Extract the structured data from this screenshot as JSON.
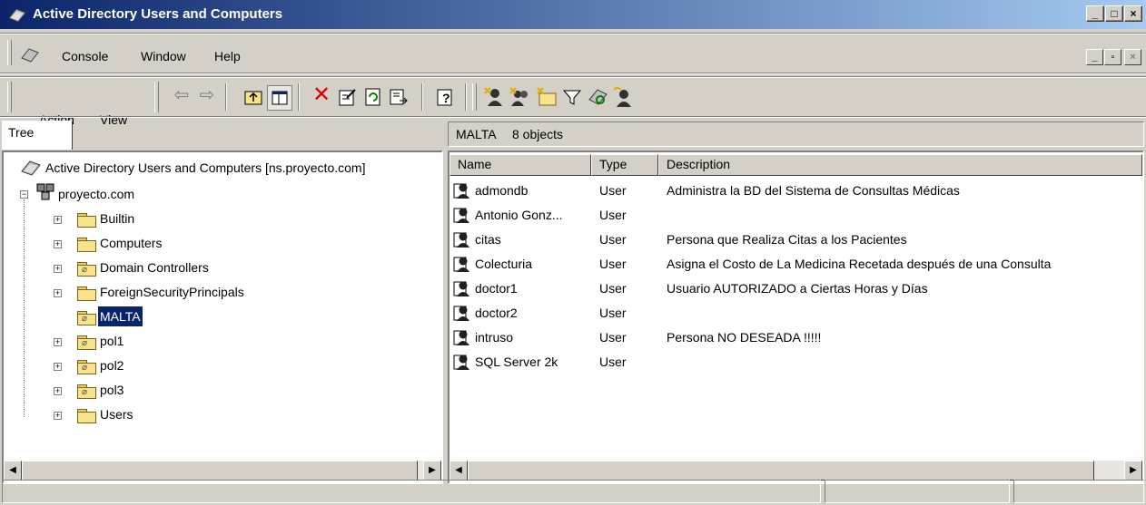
{
  "window": {
    "title": "Active Directory Users and Computers",
    "caption_buttons": [
      "_",
      "□",
      "×"
    ]
  },
  "menu": {
    "items": [
      "Console",
      "Window",
      "Help"
    ],
    "mdi_buttons": [
      "_",
      "▫",
      "×"
    ]
  },
  "toolbar": {
    "action_label": "Action",
    "view_label": "View",
    "icons": [
      "back-icon",
      "forward-icon",
      "up-folder-icon",
      "show-tree-icon",
      "delete-icon",
      "properties-icon",
      "refresh-icon",
      "export-icon",
      "help-icon",
      "new-user-icon",
      "new-group-icon",
      "new-ou-icon",
      "filter-icon",
      "find-icon",
      "add-to-group-icon"
    ]
  },
  "tree": {
    "tab_label": "Tree",
    "root_label": "Active Directory Users and Computers [ns.proyecto.com]",
    "domain_label": "proyecto.com",
    "nodes": [
      {
        "label": "Builtin",
        "kind": "container"
      },
      {
        "label": "Computers",
        "kind": "container"
      },
      {
        "label": "Domain Controllers",
        "kind": "ou"
      },
      {
        "label": "ForeignSecurityPrincipals",
        "kind": "container"
      },
      {
        "label": "MALTA",
        "kind": "ou",
        "selected": true
      },
      {
        "label": "pol1",
        "kind": "ou"
      },
      {
        "label": "pol2",
        "kind": "ou"
      },
      {
        "label": "pol3",
        "kind": "ou"
      },
      {
        "label": "Users",
        "kind": "container"
      }
    ]
  },
  "list": {
    "header_title": "MALTA",
    "header_count": "8 objects",
    "columns": [
      "Name",
      "Type",
      "Description"
    ],
    "rows": [
      {
        "name": "admondb",
        "type": "User",
        "description": "Administra la BD del Sistema de Consultas Médicas"
      },
      {
        "name": "Antonio Gonz...",
        "type": "User",
        "description": ""
      },
      {
        "name": "citas",
        "type": "User",
        "description": "Persona que Realiza Citas a los Pacientes"
      },
      {
        "name": "Colecturia",
        "type": "User",
        "description": "Asigna el Costo de La Medicina Recetada después de una Consulta"
      },
      {
        "name": "doctor1",
        "type": "User",
        "description": "Usuario AUTORIZADO a Ciertas Horas y Días"
      },
      {
        "name": "doctor2",
        "type": "User",
        "description": ""
      },
      {
        "name": "intruso",
        "type": "User",
        "description": "Persona NO DESEADA !!!!!"
      },
      {
        "name": "SQL Server 2k",
        "type": "User",
        "description": ""
      }
    ]
  },
  "colors": {
    "titlebar_start": "#0a246a",
    "titlebar_end": "#a6caf0",
    "selection": "#0a246a",
    "face": "#d4d0c8"
  }
}
